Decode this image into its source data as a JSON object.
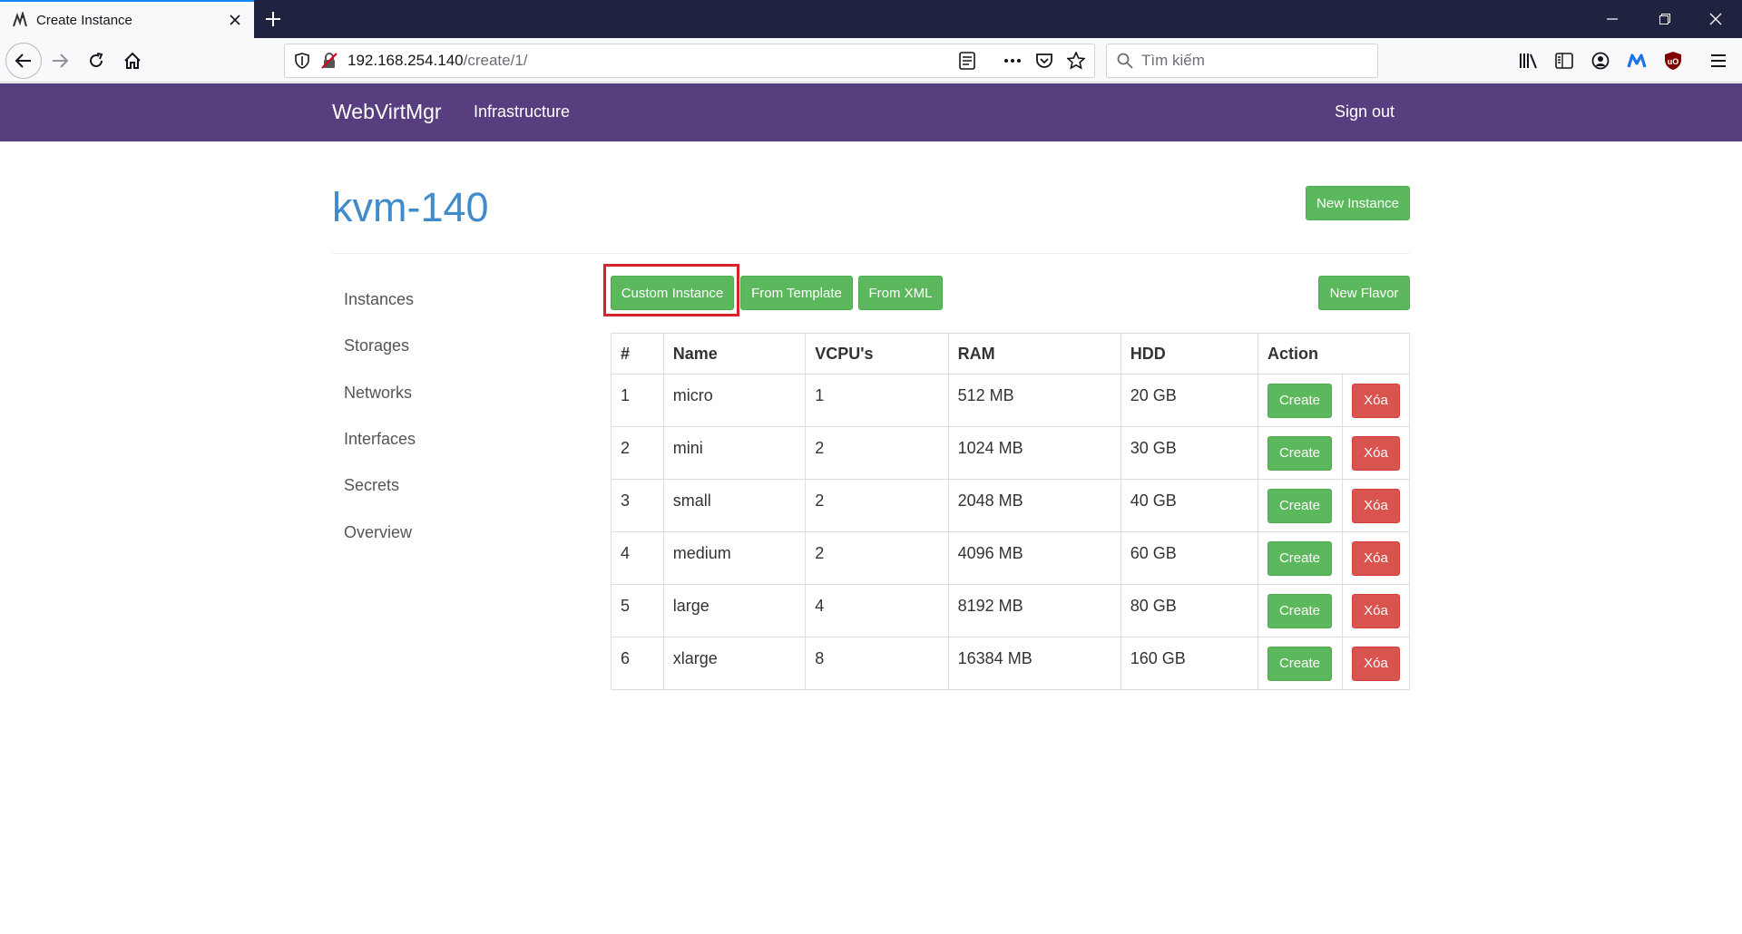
{
  "browser": {
    "tab_title": "Create Instance",
    "url_host": "192.168.254.140",
    "url_path": "/create/1/",
    "search_placeholder": "Tìm kiếm"
  },
  "app": {
    "brand": "WebVirtMgr",
    "nav_infrastructure": "Infrastructure",
    "nav_signout": "Sign out"
  },
  "page": {
    "title": "kvm-140",
    "new_instance_label": "New Instance",
    "custom_instance_label": "Custom Instance",
    "from_template_label": "From Template",
    "from_xml_label": "From XML",
    "new_flavor_label": "New Flavor"
  },
  "sidebar": {
    "items": [
      {
        "label": "Instances"
      },
      {
        "label": "Storages"
      },
      {
        "label": "Networks"
      },
      {
        "label": "Interfaces"
      },
      {
        "label": "Secrets"
      },
      {
        "label": "Overview"
      }
    ]
  },
  "table": {
    "headers": [
      "#",
      "Name",
      "VCPU's",
      "RAM",
      "HDD",
      "Action"
    ],
    "create_label": "Create",
    "delete_label": "Xóa",
    "rows": [
      {
        "num": "1",
        "name": "micro",
        "vcpu": "1",
        "ram": "512 MB",
        "hdd": "20 GB"
      },
      {
        "num": "2",
        "name": "mini",
        "vcpu": "2",
        "ram": "1024 MB",
        "hdd": "30 GB"
      },
      {
        "num": "3",
        "name": "small",
        "vcpu": "2",
        "ram": "2048 MB",
        "hdd": "40 GB"
      },
      {
        "num": "4",
        "name": "medium",
        "vcpu": "2",
        "ram": "4096 MB",
        "hdd": "60 GB"
      },
      {
        "num": "5",
        "name": "large",
        "vcpu": "4",
        "ram": "8192 MB",
        "hdd": "80 GB"
      },
      {
        "num": "6",
        "name": "xlarge",
        "vcpu": "8",
        "ram": "16384 MB",
        "hdd": "160 GB"
      }
    ]
  },
  "colors": {
    "navbar": "#573e7e",
    "title": "#428bca",
    "success": "#5cb85c",
    "danger": "#d9534f",
    "highlight": "#d6222a"
  }
}
